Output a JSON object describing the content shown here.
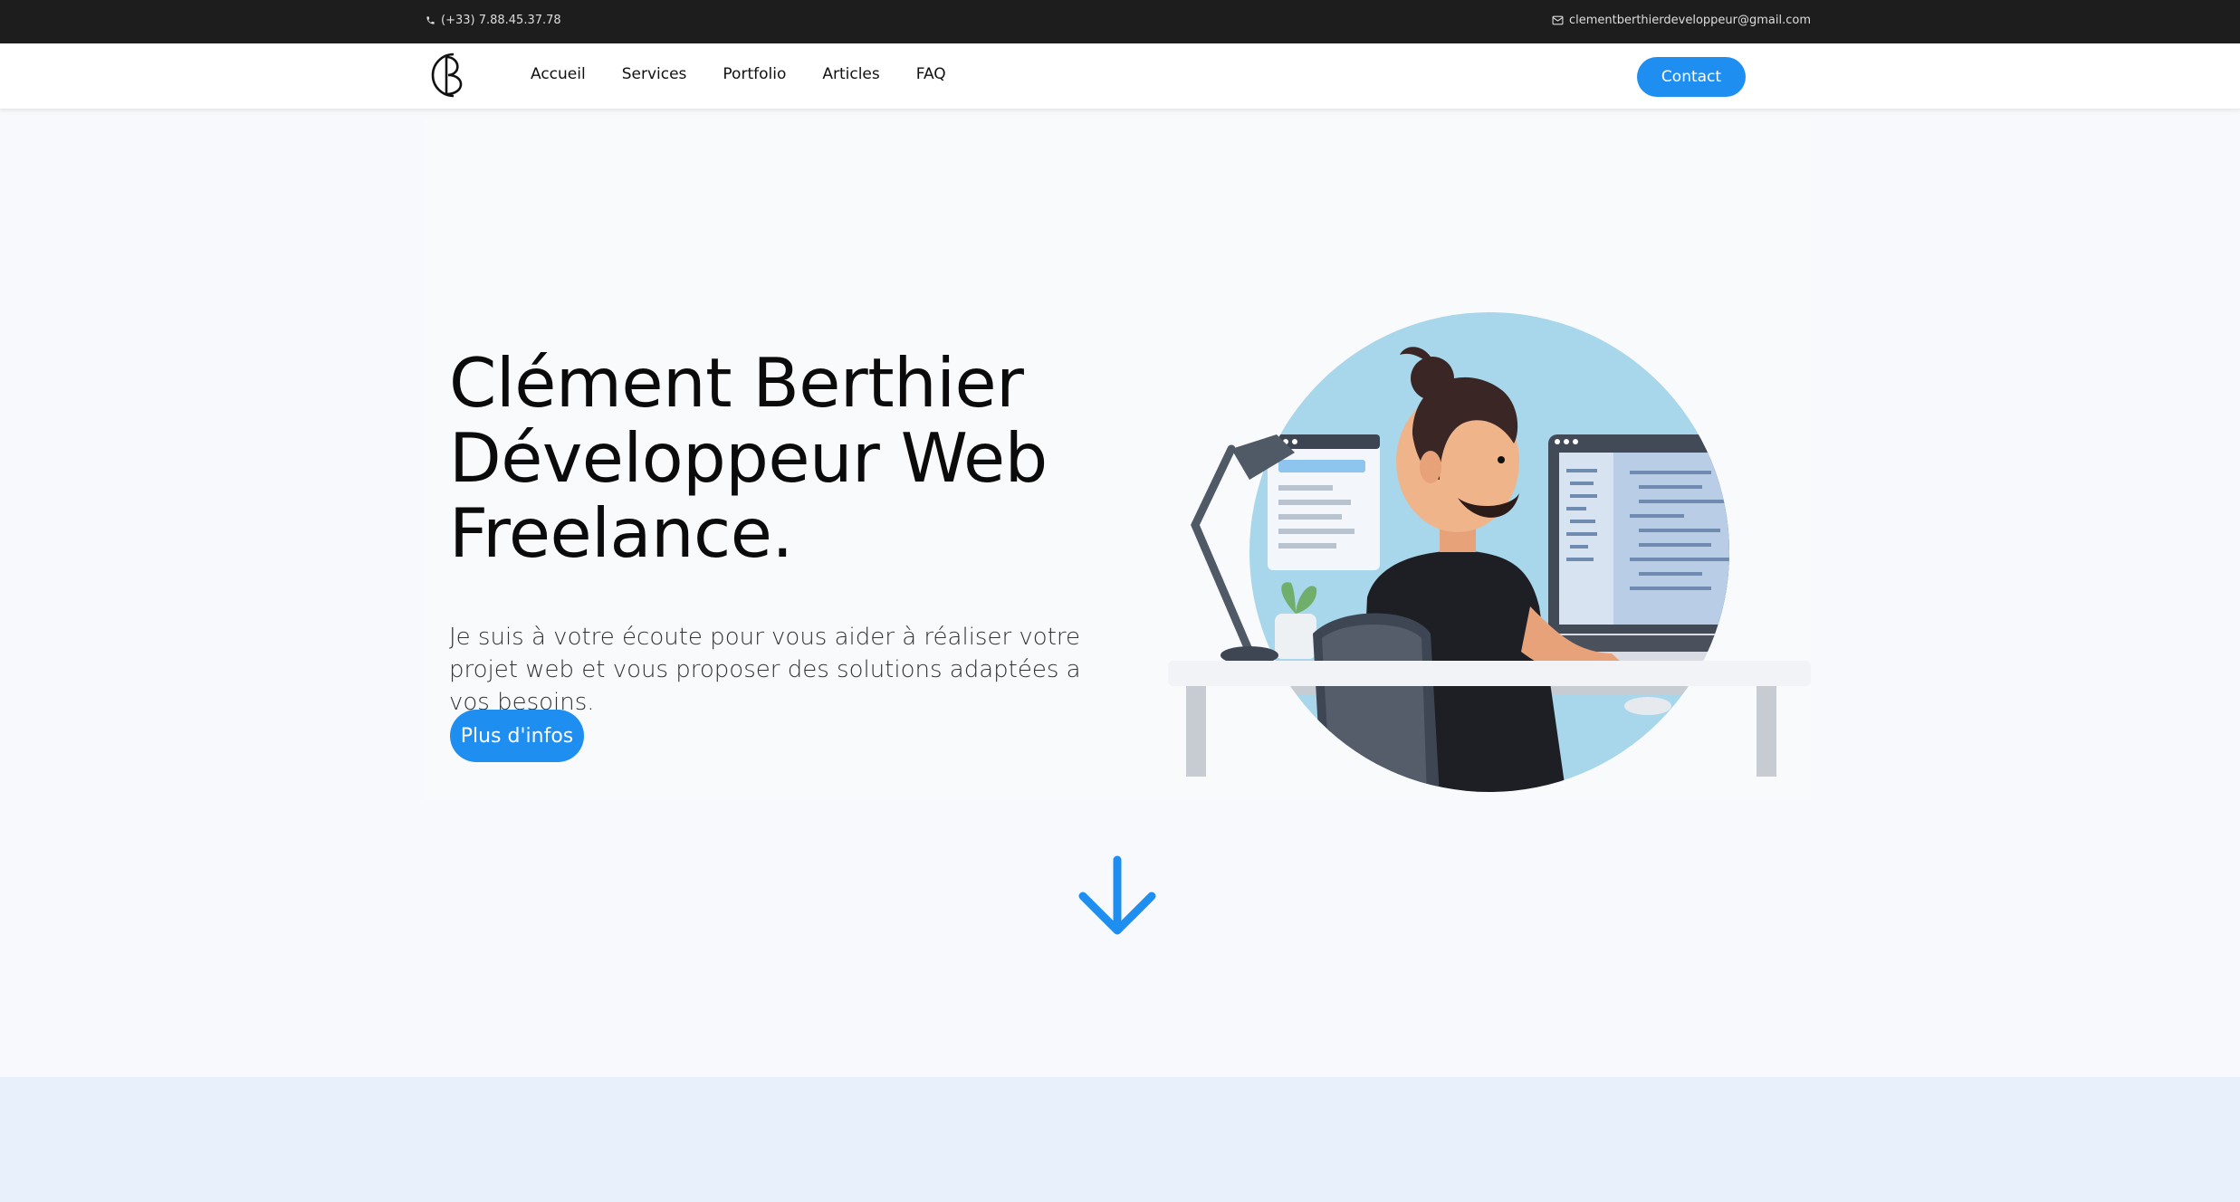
{
  "topbar": {
    "phone": "(+33) 7.88.45.37.78",
    "email": "clementberthierdeveloppeur@gmail.com"
  },
  "nav": {
    "logo_alt": "CB",
    "links": [
      "Accueil",
      "Services",
      "Portfolio",
      "Articles",
      "FAQ"
    ],
    "contact_label": "Contact"
  },
  "hero": {
    "title_lines": [
      "Clément Berthier",
      "Développeur Web",
      "Freelance."
    ],
    "text": "Je suis à votre écoute pour vous aider à réaliser votre projet web et vous proposer des solutions adaptées a vos besoins.",
    "button_label": "Plus d'infos"
  },
  "colors": {
    "accent": "#1f8ef1",
    "topbar": "#1d1d1d",
    "band": "#e8f0fb"
  },
  "icons": {
    "phone": "phone-icon",
    "email": "mail-icon",
    "scroll": "arrow-down-icon"
  }
}
